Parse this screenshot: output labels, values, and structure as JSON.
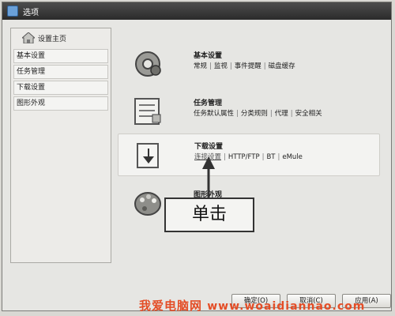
{
  "window": {
    "title": "选项"
  },
  "sidebar": {
    "home_label": "设置主页",
    "items": [
      {
        "label": "基本设置"
      },
      {
        "label": "任务管理"
      },
      {
        "label": "下载设置"
      },
      {
        "label": "图形外观"
      }
    ]
  },
  "sections": [
    {
      "title": "基本设置",
      "links": [
        "常规",
        "监视",
        "事件提醒",
        "磁盘缓存"
      ]
    },
    {
      "title": "任务管理",
      "links": [
        "任务默认属性",
        "分类规则",
        "代理",
        "安全相关"
      ]
    },
    {
      "title": "下载设置",
      "links": [
        "连接设置",
        "HTTP/FTP",
        "BT",
        "eMule"
      ]
    },
    {
      "title": "图形外观",
      "links": []
    }
  ],
  "callout": {
    "text": "单击"
  },
  "buttons": {
    "ok": "确定(O)",
    "cancel": "取消(C)",
    "apply": "应用(A)"
  },
  "watermark": {
    "text": "我爱电脑网",
    "url": "www.woaidiannao.com"
  },
  "colors": {
    "titlebar": "#333333",
    "watermark": "#e44d26",
    "callout_border": "#333333"
  }
}
